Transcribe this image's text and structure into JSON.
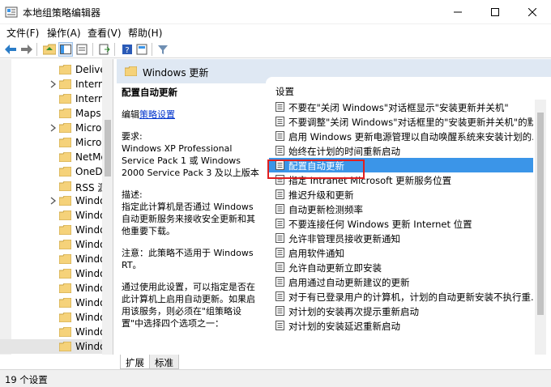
{
  "window": {
    "title": "本地组策略编辑器"
  },
  "menu": [
    "文件(F)",
    "操作(A)",
    "查看(V)",
    "帮助(H)"
  ],
  "tree": {
    "items": [
      {
        "label": "Delive",
        "arrow": false
      },
      {
        "label": "Intern",
        "arrow": true
      },
      {
        "label": "Intern",
        "arrow": false
      },
      {
        "label": "Maps",
        "arrow": false
      },
      {
        "label": "Micro",
        "arrow": true
      },
      {
        "label": "Micro",
        "arrow": false
      },
      {
        "label": "NetMe",
        "arrow": false
      },
      {
        "label": "OneDr",
        "arrow": false
      },
      {
        "label": "RSS 源",
        "arrow": false
      },
      {
        "label": "Windo",
        "arrow": true
      },
      {
        "label": "Windo",
        "arrow": false
      },
      {
        "label": "Windo",
        "arrow": false
      },
      {
        "label": "Windo",
        "arrow": false
      },
      {
        "label": "Windo",
        "arrow": false
      },
      {
        "label": "Windo",
        "arrow": false
      },
      {
        "label": "Windo",
        "arrow": false
      },
      {
        "label": "Windo",
        "arrow": false
      },
      {
        "label": "Windo",
        "arrow": false
      },
      {
        "label": "Windo",
        "arrow": false
      },
      {
        "label": "Windo",
        "arrow": false,
        "selected": true
      }
    ]
  },
  "header": {
    "title": "Windows 更新"
  },
  "description": {
    "title": "配置自动更新",
    "edit_prefix": "编辑",
    "edit_link": "策略设置",
    "requirements_label": "要求:",
    "requirements": "Windows XP Professional Service Pack 1 或 Windows 2000 Service Pack 3 及以上版本",
    "desc_label": "描述:",
    "desc": "指定此计算机是否通过 Windows 自动更新服务来接收安全更新和其他重要下载。",
    "note": "注意：此策略不适用于 Windows RT。",
    "more": "通过使用此设置，可以指定是否在此计算机上启用自动更新。如果启用该服务，则必须在\"组策略设置\"中选择四个选项之一："
  },
  "settings": {
    "column_header": "设置",
    "items": [
      "不要在\"关闭 Windows\"对话框显示\"安装更新并关机\"",
      "不要调整\"关闭 Windows\"对话框里的\"安装更新并关机\"的默...",
      "启用 Windows 更新电源管理以自动唤醒系统来安装计划的...",
      "始终在计划的时间重新启动",
      "配置自动更新",
      "指定 Intranet Microsoft 更新服务位置",
      "推迟升级和更新",
      "自动更新检测频率",
      "不要连接任何 Windows 更新 Internet 位置",
      "允许非管理员接收更新通知",
      "启用软件通知",
      "允许自动更新立即安装",
      "启用通过自动更新建议的更新",
      "对于有已登录用户的计算机，计划的自动更新安装不执行重...",
      "对计划的安装再次提示重新启动",
      "对计划的安装延迟重新启动"
    ],
    "selected_index": 4
  },
  "tabs": [
    "扩展",
    "标准"
  ],
  "status": {
    "text": "19 个设置"
  },
  "colors": {
    "selection": "#3b95e8",
    "header_bg": "#dfe8f3",
    "highlight_box": "#e02020",
    "folder": "#f5d27a"
  }
}
